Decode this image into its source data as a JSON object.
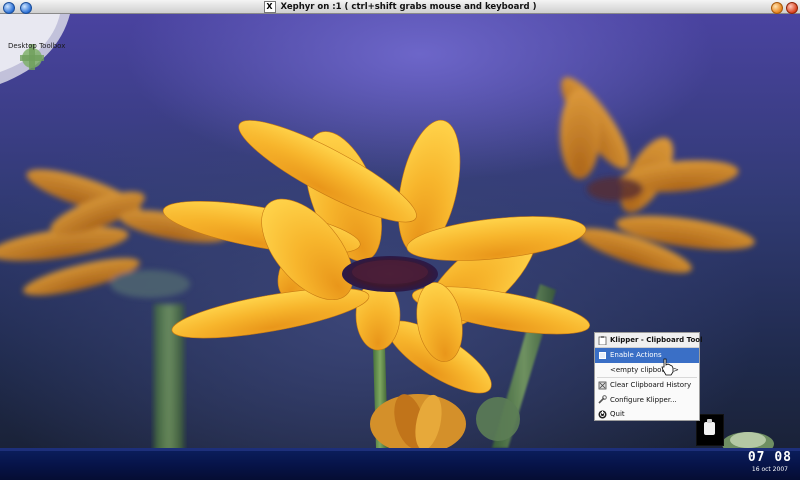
{
  "window": {
    "title": "Xephyr on :1 ( ctrl+shift grabs mouse and keyboard )",
    "x_logo": "X",
    "icons": [
      "menu-icon",
      "minimize-icon",
      "close-icon"
    ]
  },
  "desktop": {
    "toolbox_label": "Desktop Toolbox",
    "wallpaper": "orange-daisies"
  },
  "klipper_menu": {
    "title": "Klipper - Clipboard Tool",
    "items": [
      {
        "label": "Enable Actions",
        "icon": "checkbox-icon",
        "highlighted": true
      },
      {
        "label": "<empty clipboard>",
        "icon": "",
        "highlighted": false
      },
      {
        "label": "Clear Clipboard History",
        "icon": "clear-history-icon",
        "highlighted": false
      },
      {
        "label": "Configure Klipper...",
        "icon": "configure-icon",
        "highlighted": false
      },
      {
        "label": "Quit",
        "icon": "quit-icon",
        "highlighted": false
      }
    ]
  },
  "taskbar": {
    "clock_time": "07 08",
    "clock_date": "16 oct 2007"
  },
  "colors": {
    "menu_highlight": "#3a6fc6",
    "taskbar": "#07144a",
    "petal": "#f7b52c"
  }
}
